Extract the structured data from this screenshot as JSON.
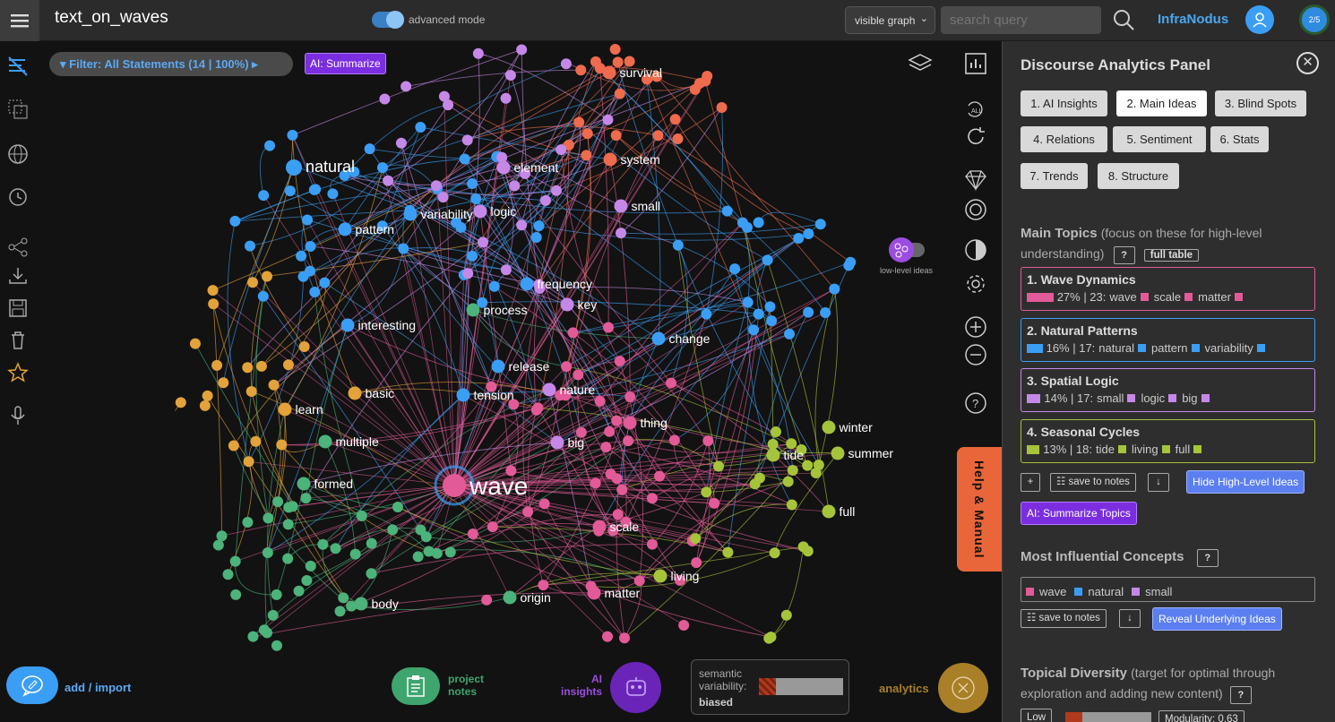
{
  "app": {
    "title": "text_on_waves",
    "advanced_mode_label": "advanced mode",
    "brand": "InfraNodus",
    "step_badge": "2/5"
  },
  "search": {
    "graph_select": "visible graph",
    "placeholder": "search query"
  },
  "graph": {
    "filter_label": "Filter: All Statements (14 | 100%)",
    "ai_summarize": "AI: Summarize",
    "low_level_label": "low-level ideas",
    "help_manual": "Help & Manual",
    "node_labels": [
      {
        "text": "survival",
        "color": "#ee6b4d",
        "big": false
      },
      {
        "text": "natural",
        "color": "#3b9ef5",
        "big": true
      },
      {
        "text": "element",
        "color": "#c688e8",
        "big": false
      },
      {
        "text": "system",
        "color": "#ee6b4d",
        "big": false
      },
      {
        "text": "variability",
        "color": "#3b9ef5",
        "big": false
      },
      {
        "text": "logic",
        "color": "#c688e8",
        "big": false
      },
      {
        "text": "small",
        "color": "#c688e8",
        "big": false
      },
      {
        "text": "pattern",
        "color": "#3b9ef5",
        "big": false
      },
      {
        "text": "frequency",
        "color": "#3b9ef5",
        "big": false
      },
      {
        "text": "process",
        "color": "#4cb37a",
        "big": false
      },
      {
        "text": "key",
        "color": "#c688e8",
        "big": false
      },
      {
        "text": "interesting",
        "color": "#3b9ef5",
        "big": false
      },
      {
        "text": "change",
        "color": "#3b9ef5",
        "big": false
      },
      {
        "text": "release",
        "color": "#3b9ef5",
        "big": false
      },
      {
        "text": "basic",
        "color": "#e3a23a",
        "big": false
      },
      {
        "text": "tension",
        "color": "#3b9ef5",
        "big": false
      },
      {
        "text": "nature",
        "color": "#c688e8",
        "big": false
      },
      {
        "text": "learn",
        "color": "#e3a23a",
        "big": false
      },
      {
        "text": "thing",
        "color": "#e35a98",
        "big": false
      },
      {
        "text": "winter",
        "color": "#a6c43a",
        "big": false
      },
      {
        "text": "multiple",
        "color": "#4cb37a",
        "big": false
      },
      {
        "text": "big",
        "color": "#c688e8",
        "big": false
      },
      {
        "text": "tide",
        "color": "#a6c43a",
        "big": false
      },
      {
        "text": "summer",
        "color": "#a6c43a",
        "big": false
      },
      {
        "text": "formed",
        "color": "#4cb37a",
        "big": false
      },
      {
        "text": "wave",
        "color": "#e35a98",
        "big": true
      },
      {
        "text": "full",
        "color": "#a6c43a",
        "big": false
      },
      {
        "text": "scale",
        "color": "#e35a98",
        "big": false
      },
      {
        "text": "living",
        "color": "#a6c43a",
        "big": false
      },
      {
        "text": "body",
        "color": "#4cb37a",
        "big": false
      },
      {
        "text": "origin",
        "color": "#4cb37a",
        "big": false
      },
      {
        "text": "matter",
        "color": "#e35a98",
        "big": false
      }
    ]
  },
  "bottom": {
    "add_import": "add / import",
    "project_notes": "project notes",
    "ai_insights": "AI insights",
    "semantic_variability_label": "semantic variability:",
    "semantic_variability_value": "biased",
    "semantic_variability_fill": 0.2,
    "analytics": "analytics"
  },
  "panel": {
    "title": "Discourse Analytics Panel",
    "tabs": [
      {
        "label": "1. AI Insights",
        "active": false
      },
      {
        "label": "2. Main Ideas",
        "active": true
      },
      {
        "label": "3. Blind Spots",
        "active": false
      },
      {
        "label": "4. Relations",
        "active": false
      },
      {
        "label": "5. Sentiment",
        "active": false
      },
      {
        "label": "6. Stats",
        "active": false
      },
      {
        "label": "7. Trends",
        "active": false
      },
      {
        "label": "8. Structure",
        "active": false
      }
    ],
    "main_topics": {
      "heading": "Main Topics",
      "subheading": "(focus on these for high-level understanding)",
      "help": "?",
      "full_table": "full table",
      "topics": [
        {
          "title": "1. Wave Dynamics",
          "color": "#e35a98",
          "percent": 27,
          "stats": "27% | 23:",
          "words": [
            "wave",
            "scale",
            "matter"
          ]
        },
        {
          "title": "2. Natural Patterns",
          "color": "#3b9ef5",
          "percent": 16,
          "stats": "16% | 17:",
          "words": [
            "natural",
            "pattern",
            "variability"
          ]
        },
        {
          "title": "3. Spatial Logic",
          "color": "#c688e8",
          "percent": 14,
          "stats": "14% | 17:",
          "words": [
            "small",
            "logic",
            "big"
          ]
        },
        {
          "title": "4. Seasonal Cycles",
          "color": "#a6c43a",
          "percent": 13,
          "stats": "13% | 18:",
          "words": [
            "tide",
            "living",
            "full"
          ]
        }
      ],
      "plus": "+",
      "save_notes": "save to notes",
      "download": "↓",
      "hide_btn": "Hide High-Level Ideas",
      "ai_summarize_topics": "AI: Summarize Topics"
    },
    "influential": {
      "heading": "Most Influential Concepts",
      "help": "?",
      "concepts": [
        {
          "word": "wave",
          "color": "#e35a98"
        },
        {
          "word": "natural",
          "color": "#3b9ef5"
        },
        {
          "word": "small",
          "color": "#c688e8"
        }
      ],
      "save_notes": "save to notes",
      "download": "↓",
      "reveal_btn": "Reveal Underlying Ideas"
    },
    "diversity": {
      "heading": "Topical Diversity",
      "subheading": "(target for optimal through exploration and adding new content)",
      "help": "?",
      "level": "Low",
      "modularity": "Modularity: 0.63",
      "fill": 0.2
    }
  }
}
